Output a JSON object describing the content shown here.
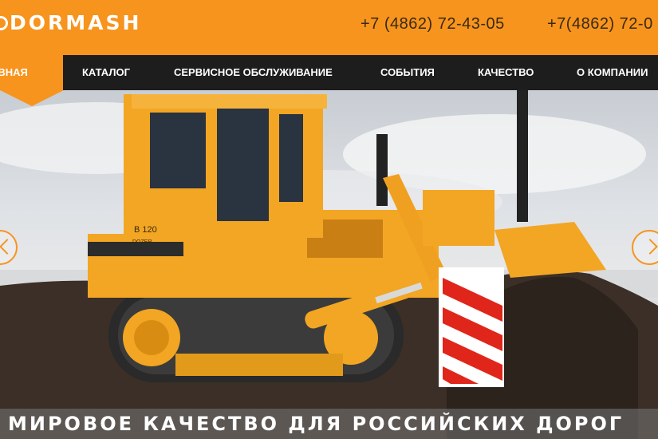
{
  "brand": {
    "logo_text": "DORMASH"
  },
  "header": {
    "phone_1": "+7 (4862) 72-43-05",
    "phone_2": "+7(4862) 72-0"
  },
  "nav": {
    "items": [
      {
        "label": "АВНАЯ"
      },
      {
        "label": "КАТАЛОГ"
      },
      {
        "label": "СЕРВИСНОЕ ОБСЛУЖИВАНИЕ"
      },
      {
        "label": "СОБЫТИЯ"
      },
      {
        "label": "КАЧЕСТВО"
      },
      {
        "label": "О КОМПАНИИ"
      }
    ]
  },
  "hero": {
    "machine_badge": "B 120",
    "machine_sub": "DOZER",
    "tagline": "МИРОВОЕ КАЧЕСТВО ДЛЯ РОССИЙСКИХ ДОРОГ"
  },
  "colors": {
    "brand_orange": "#f7941d",
    "nav_bg": "#1d1d1d",
    "machine_yellow": "#f2a623"
  }
}
